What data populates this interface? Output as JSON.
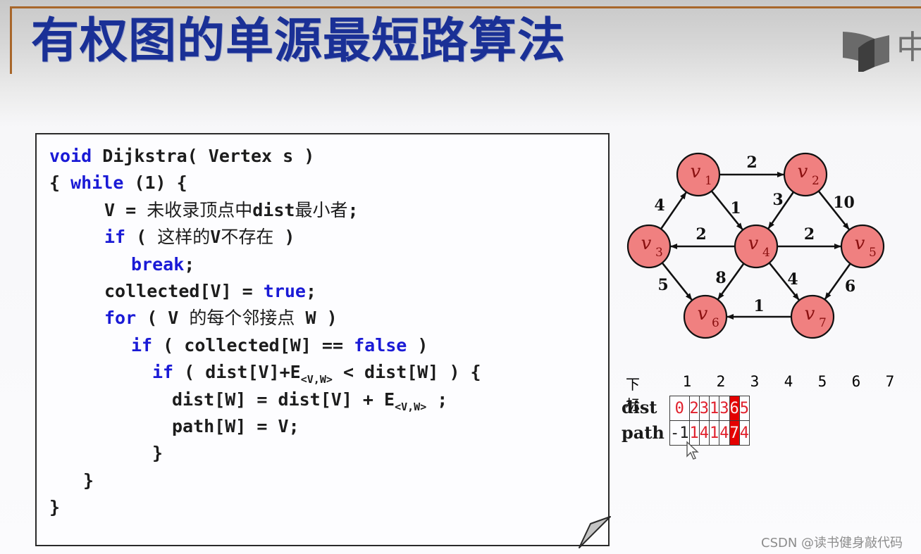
{
  "slide": {
    "title": "有权图的单源最短路算法",
    "logo_text": "中",
    "watermark": "CSDN @读书健身敲代码",
    "accent_color": "#a8662a",
    "title_color": "#1a3096"
  },
  "code": {
    "lines": [
      {
        "indent": 0,
        "parts": [
          {
            "t": "void",
            "k": "kw"
          },
          {
            "t": " Dijkstra( Vertex s )"
          }
        ]
      },
      {
        "indent": 0,
        "parts": [
          {
            "t": "{ "
          },
          {
            "t": "while",
            "k": "kw"
          },
          {
            "t": " (1) {"
          }
        ]
      },
      {
        "indent": 2,
        "parts": [
          {
            "t": "V = "
          },
          {
            "t": "未收录顶点中",
            "k": "cjk"
          },
          {
            "t": "dist"
          },
          {
            "t": "最小者",
            "k": "cjk"
          },
          {
            "t": ";"
          }
        ]
      },
      {
        "indent": 2,
        "parts": [
          {
            "t": "if",
            "k": "kw"
          },
          {
            "t": " ( "
          },
          {
            "t": "这样的",
            "k": "cjk"
          },
          {
            "t": "V"
          },
          {
            "t": "不存在",
            "k": "cjk"
          },
          {
            "t": " )"
          }
        ]
      },
      {
        "indent": 3,
        "parts": [
          {
            "t": "break",
            "k": "kw"
          },
          {
            "t": ";"
          }
        ]
      },
      {
        "indent": 2,
        "parts": [
          {
            "t": "collected[V] = "
          },
          {
            "t": "true",
            "k": "kw"
          },
          {
            "t": ";"
          }
        ]
      },
      {
        "indent": 2,
        "parts": [
          {
            "t": "for",
            "k": "kw"
          },
          {
            "t": " ( V "
          },
          {
            "t": "的每个邻接点",
            "k": "cjk"
          },
          {
            "t": " W )"
          }
        ]
      },
      {
        "indent": 3,
        "parts": [
          {
            "t": "if",
            "k": "kw"
          },
          {
            "t": " ( collected[W] == "
          },
          {
            "t": "false",
            "k": "kw"
          },
          {
            "t": " )"
          }
        ]
      },
      {
        "indent": 4,
        "parts": [
          {
            "t": "if",
            "k": "kw"
          },
          {
            "t": " ( dist[V]+E"
          },
          {
            "t": "<V,W>",
            "k": "sub"
          },
          {
            "t": " < dist[W] ) {"
          }
        ]
      },
      {
        "indent": 5,
        "parts": [
          {
            "t": "dist[W] = dist[V] + E"
          },
          {
            "t": "<V,W>",
            "k": "sub"
          },
          {
            "t": " ;"
          }
        ]
      },
      {
        "indent": 5,
        "parts": [
          {
            "t": "path[W] = V;"
          }
        ]
      },
      {
        "indent": 4,
        "parts": [
          {
            "t": "}"
          }
        ]
      },
      {
        "indent": 1,
        "parts": [
          {
            "t": "}"
          }
        ]
      },
      {
        "indent": 0,
        "parts": [
          {
            "t": "}"
          }
        ]
      }
    ]
  },
  "graph": {
    "node_color": "#f08080",
    "nodes": [
      {
        "id": "v1",
        "label": "v",
        "sub": "1"
      },
      {
        "id": "v2",
        "label": "v",
        "sub": "2"
      },
      {
        "id": "v3",
        "label": "v",
        "sub": "3"
      },
      {
        "id": "v4",
        "label": "v",
        "sub": "4"
      },
      {
        "id": "v5",
        "label": "v",
        "sub": "5"
      },
      {
        "id": "v6",
        "label": "v",
        "sub": "6"
      },
      {
        "id": "v7",
        "label": "v",
        "sub": "7"
      }
    ],
    "edges": [
      {
        "from": "v1",
        "to": "v2",
        "weight": "2"
      },
      {
        "from": "v1",
        "to": "v4",
        "weight": "1"
      },
      {
        "from": "v2",
        "to": "v4",
        "weight": "3"
      },
      {
        "from": "v2",
        "to": "v5",
        "weight": "10"
      },
      {
        "from": "v3",
        "to": "v1",
        "weight": "4"
      },
      {
        "from": "v4",
        "to": "v3",
        "weight": "2"
      },
      {
        "from": "v4",
        "to": "v5",
        "weight": "2"
      },
      {
        "from": "v3",
        "to": "v6",
        "weight": "5"
      },
      {
        "from": "v4",
        "to": "v6",
        "weight": "8"
      },
      {
        "from": "v4",
        "to": "v7",
        "weight": "4"
      },
      {
        "from": "v5",
        "to": "v7",
        "weight": "6"
      },
      {
        "from": "v7",
        "to": "v6",
        "weight": "1"
      }
    ]
  },
  "table": {
    "index_label": "下标",
    "indices": [
      "1",
      "2",
      "3",
      "4",
      "5",
      "6",
      "7"
    ],
    "dist_label": "dist",
    "path_label": "path",
    "dist": [
      "0",
      "2",
      "3",
      "1",
      "3",
      "6",
      "5"
    ],
    "path": [
      "-1",
      "1",
      "4",
      "1",
      "4",
      "7",
      "4"
    ],
    "highlight_index": 6,
    "highlight_color": "#e40000",
    "value_color": "#e0202c"
  }
}
